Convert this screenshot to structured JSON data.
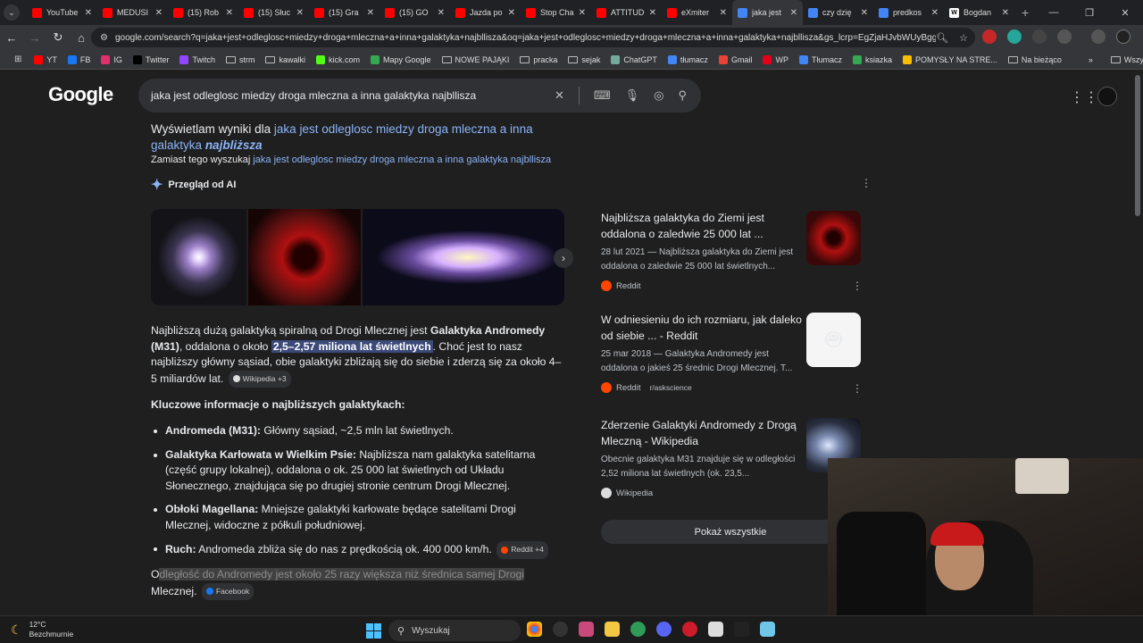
{
  "tabs": [
    {
      "title": "YouTube",
      "color": "#ff0000"
    },
    {
      "title": "MEDUSI",
      "color": "#ff0000"
    },
    {
      "title": "(15) Rob",
      "color": "#ff0000"
    },
    {
      "title": "(15) Słuc",
      "color": "#ff0000"
    },
    {
      "title": "(15) Gra",
      "color": "#ff0000"
    },
    {
      "title": "(15) GO",
      "color": "#ff0000"
    },
    {
      "title": "Jazda po",
      "color": "#ff0000"
    },
    {
      "title": "Stop Cha",
      "color": "#ff0000"
    },
    {
      "title": "ATTITUD",
      "color": "#ff0000"
    },
    {
      "title": "eXmiter",
      "color": "#ff0000"
    },
    {
      "title": "jaka jest",
      "color": "#4285f4",
      "active": true
    },
    {
      "title": "czy dzię",
      "color": "#4285f4"
    },
    {
      "title": "predkos",
      "color": "#4285f4"
    },
    {
      "title": "Bogdan",
      "color": "#ffffff",
      "fav_letter": "W"
    }
  ],
  "new_tab_label": "+",
  "url": "google.com/search?q=jaka+jest+odleglosc+miedzy+droga+mleczna+a+inna+galaktyka+najbllisza&oq=jaka+jest+odleglosc+miedzy+droga+mleczna+a+inna+galaktyka+najbllisza&gs_lcrp=EgZjaHJvbWUyBggAEEUYO...",
  "bookmarks": [
    {
      "label": "YT",
      "kind": "icon",
      "color": "#ff0000"
    },
    {
      "label": "FB",
      "kind": "icon",
      "color": "#1877f2"
    },
    {
      "label": "IG",
      "kind": "icon",
      "color": "#e1306c"
    },
    {
      "label": "Twitter",
      "kind": "icon",
      "color": "#000000"
    },
    {
      "label": "Twitch",
      "kind": "icon",
      "color": "#9146ff"
    },
    {
      "label": "strm",
      "kind": "folder"
    },
    {
      "label": "kawalki",
      "kind": "folder"
    },
    {
      "label": "kick.com",
      "kind": "icon",
      "color": "#53fc18"
    },
    {
      "label": "Mapy Google",
      "kind": "icon",
      "color": "#34a853"
    },
    {
      "label": "NOWE PAJĄKI",
      "kind": "folder"
    },
    {
      "label": "pracka",
      "kind": "folder"
    },
    {
      "label": "sejak",
      "kind": "folder"
    },
    {
      "label": "ChatGPT",
      "kind": "icon",
      "color": "#74aa9c"
    },
    {
      "label": "tłumacz",
      "kind": "icon",
      "color": "#4285f4"
    },
    {
      "label": "Gmail",
      "kind": "icon",
      "color": "#ea4335"
    },
    {
      "label": "WP",
      "kind": "icon",
      "color": "#e2001a"
    },
    {
      "label": "Tłumacz",
      "kind": "icon",
      "color": "#4285f4"
    },
    {
      "label": "ksiazka",
      "kind": "icon",
      "color": "#34a853"
    },
    {
      "label": "POMYSŁY NA STRE...",
      "kind": "icon",
      "color": "#fbbc04"
    },
    {
      "label": "Na bieżąco",
      "kind": "folder"
    }
  ],
  "bookmarks_more": "»",
  "all_bookmarks": "Wszystkie zakładki",
  "google": {
    "logo": "Google",
    "query": "jaka jest odleglosc miedzy droga mleczna a inna galaktyka najbllisza"
  },
  "correction": {
    "prefix": "Wyświetlam wyniki dla",
    "link_part1": "jaka jest odleglosc miedzy droga mleczna a inna galaktyka",
    "link_bold": "najbliższa",
    "instead_prefix": "Zamiast tego wyszukaj",
    "instead_link": "jaka jest odleglosc miedzy droga mleczna a inna galaktyka najbllisza"
  },
  "ai_overview": {
    "title": "Przegląd od AI",
    "para_1": "Najbliższą dużą galaktyką spiralną od Drogi Mlecznej jest",
    "para_bold": "Galaktyka Andromedy (M31)",
    "para_2": ", oddalona o około",
    "para_highlight": "2,5–2,57 miliona lat świetlnych",
    "para_3": ". Choć jest to nasz najbliższy główny sąsiad, obie galaktyki zbliżają się do siebie i zderzą się za około 4–5 miliardów lat.",
    "para_chip": "Wikipedia +3",
    "key_heading": "Kluczowe informacje o najbliższych galaktykach:",
    "bullets": [
      {
        "bold": "Andromeda (M31):",
        "text": " Główny sąsiad, ~2,5 mln lat świetlnych."
      },
      {
        "bold": "Galaktyka Karłowata w Wielkim Psie:",
        "text": " Najbliższa nam galaktyka satelitarna (część grupy lokalnej), oddalona o ok. 25 000 lat świetlnych od Układu Słonecznego, znajdująca się po drugiej stronie centrum Drogi Mlecznej."
      },
      {
        "bold": "Obłoki Magellana:",
        "text": " Mniejsze galaktyki karłowate będące satelitami Drogi Mlecznej, widoczne z półkuli południowej."
      },
      {
        "bold": "Ruch:",
        "text": " Andromeda zbliża się do nas z prędkością ok. 400 000 km/h.",
        "chip": "Reddit +4"
      }
    ],
    "last_first": "O",
    "last_selected": "dległość do Andromedy jest około 25 razy większa niż średnica samej Drogi",
    "last_rest": "Mlecznej.",
    "last_chip": "Facebook"
  },
  "sources": [
    {
      "title": "Najbliższa galaktyka do Ziemi jest oddalona o zaledwie 25 000 lat ...",
      "desc": "28 lut 2021 — Najbliższa galaktyka do Ziemi jest oddalona o zaledwie 25 000 lat świetlnych...",
      "site": "Reddit",
      "sub": ""
    },
    {
      "title": "W odniesieniu do ich rozmiaru, jak daleko od siebie ... - Reddit",
      "desc": "25 mar 2018 — Galaktyka Andromedy jest oddalona o jakieś 25 średnic Drogi Mlecznej. T...",
      "site": "Reddit",
      "sub": "r/askscience"
    },
    {
      "title": "Zderzenie Galaktyki Andromedy z Drogą Mleczną - Wikipedia",
      "desc": "Obecnie galaktyka M31 znajduje się w odległości 2,52 miliona lat świetlnych (ok. 23,5...",
      "site": "Wikipedia",
      "sub": ""
    }
  ],
  "show_all": "Pokaż wszystkie",
  "taskbar": {
    "temp": "12°C",
    "weather": "Bezchmurnie",
    "search": "Wyszukaj"
  }
}
